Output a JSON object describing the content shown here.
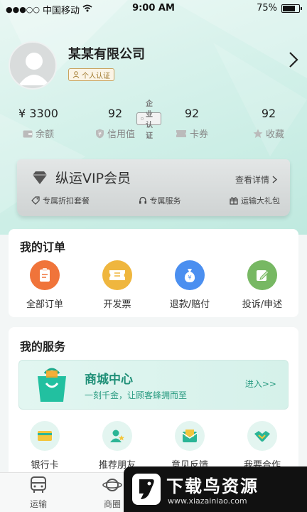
{
  "status_bar": {
    "carrier": "中国移动",
    "time": "9:00 AM",
    "battery": "75%"
  },
  "profile": {
    "company_name": "某某有限公司",
    "personal_badge": "个人认证",
    "company_badge": "企业认证"
  },
  "stats": [
    {
      "value": "¥ 3300",
      "label": "余额",
      "icon": "wallet-icon"
    },
    {
      "value": "92",
      "label": "信用值",
      "icon": "shield-icon"
    },
    {
      "value": "92",
      "label": "卡券",
      "icon": "ticket-icon"
    },
    {
      "value": "92",
      "label": "收藏",
      "icon": "star-icon"
    }
  ],
  "vip": {
    "title": "纵运VIP会员",
    "detail_link": "查看详情",
    "perks": [
      "专属折扣套餐",
      "专属服务",
      "运输大礼包"
    ]
  },
  "orders": {
    "title": "我的订单",
    "items": [
      {
        "label": "全部订单",
        "color": "#f0743a"
      },
      {
        "label": "开发票",
        "color": "#efb63e"
      },
      {
        "label": "退款/赔付",
        "color": "#4b8ff0"
      },
      {
        "label": "投诉/申述",
        "color": "#77b863"
      }
    ]
  },
  "services": {
    "title": "我的服务",
    "mall": {
      "title": "商城中心",
      "subtitle": "一刻千金，让顾客蜂拥而至",
      "enter": "进入>>"
    },
    "items": [
      {
        "label": "银行卡"
      },
      {
        "label": "推荐朋友"
      },
      {
        "label": "意见反馈"
      },
      {
        "label": "我要合作"
      }
    ]
  },
  "tabbar": {
    "items": [
      {
        "label": "运输"
      },
      {
        "label": "商圈"
      }
    ]
  },
  "watermark": {
    "title": "下载鸟资源",
    "url": "www.xiazainiao.com"
  },
  "colors": {
    "accent": "#2b9c82",
    "header_bg": "#d4f1ea"
  }
}
